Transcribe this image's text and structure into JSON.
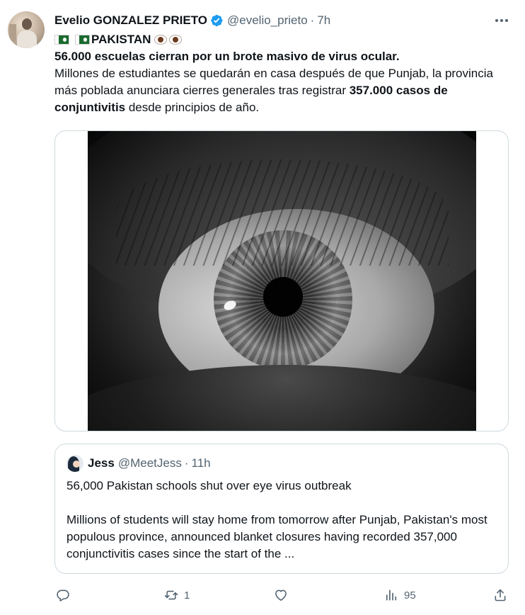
{
  "author": {
    "display_name": "Evelio GONZALEZ PRIETO",
    "handle": "@evelio_prieto",
    "separator": "·",
    "time": "7h"
  },
  "tweet": {
    "topic": "PAKISTAN",
    "headline": "56.000 escuelas cierran por un brote masivo de virus ocular.",
    "body_part1": "Millones de estudiantes se quedarán en casa después de que Punjab, la provincia más poblada anunciara cierres generales tras registrar ",
    "body_bold": "357.000 casos de conjuntivitis",
    "body_part2": " desde principios de año."
  },
  "quote": {
    "name": "Jess",
    "handle": "@MeetJess",
    "separator": "·",
    "time": "11h",
    "title": "56,000 Pakistan schools shut over eye virus outbreak",
    "body": "Millions of students will stay home from tomorrow after Punjab, Pakistan's most populous province, announced blanket closures having recorded 357,000 conjunctivitis cases since the start of the ..."
  },
  "actions": {
    "reply_count": "",
    "retweet_count": "1",
    "like_count": "",
    "views_count": "95"
  },
  "icons": {
    "verified": "verified-badge-icon",
    "more": "more-options-icon",
    "reply": "reply-icon",
    "retweet": "retweet-icon",
    "like": "heart-icon",
    "views": "views-chart-icon",
    "share": "share-icon"
  },
  "colors": {
    "text_primary": "#0f1419",
    "text_secondary": "#536471",
    "verified_blue": "#1d9bf0",
    "border": "#cfd9de",
    "flag_green": "#1a6a2e"
  }
}
